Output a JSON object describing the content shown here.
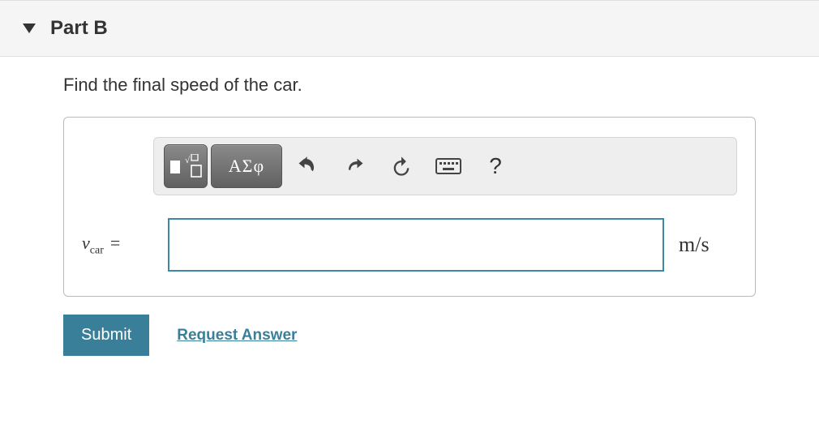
{
  "header": {
    "title": "Part B"
  },
  "prompt": "Find the final speed of the car.",
  "toolbar": {
    "greek_label": "ΑΣφ"
  },
  "input": {
    "var_symbol": "v",
    "var_subscript": "car",
    "equals": "=",
    "value": "",
    "units": "m/s"
  },
  "actions": {
    "submit": "Submit",
    "request": "Request Answer"
  }
}
